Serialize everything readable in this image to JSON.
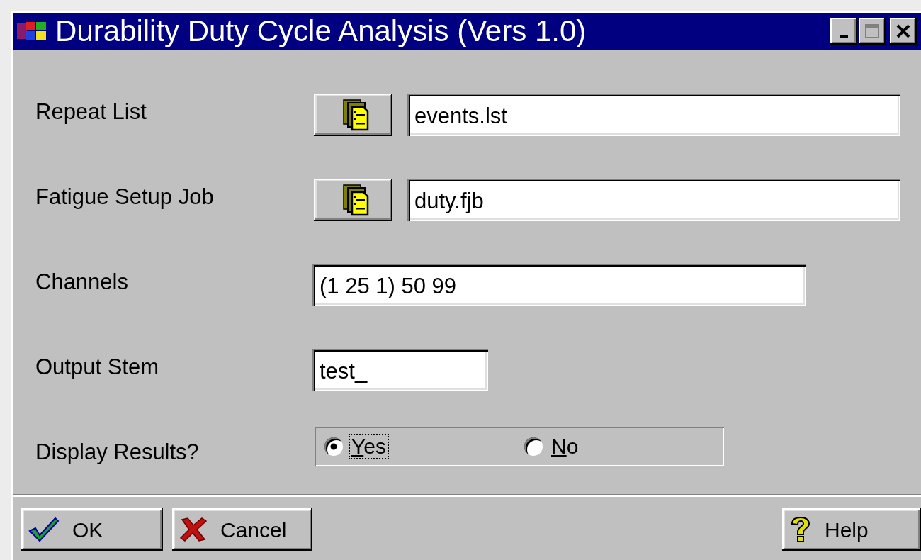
{
  "window": {
    "title": "Durability Duty Cycle Analysis (Vers 1.0)"
  },
  "fields": [
    {
      "label": "Repeat List",
      "kind": "file",
      "value": "events.lst"
    },
    {
      "label": "Fatigue Setup Job",
      "kind": "file",
      "value": "duty.fjb"
    },
    {
      "label": "Channels",
      "kind": "wide",
      "value": "(1 25 1) 50 99"
    },
    {
      "label": "Output Stem",
      "kind": "short",
      "value": "test_"
    }
  ],
  "display_results": {
    "label": "Display Results?",
    "options": [
      {
        "label": "Yes",
        "selected": true,
        "focused": true
      },
      {
        "label": "No",
        "selected": false,
        "focused": false
      }
    ]
  },
  "buttons": [
    {
      "label": "OK",
      "kind": "ok"
    },
    {
      "label": "Cancel",
      "kind": "cancel"
    },
    {
      "label": "Help",
      "kind": "help"
    }
  ]
}
